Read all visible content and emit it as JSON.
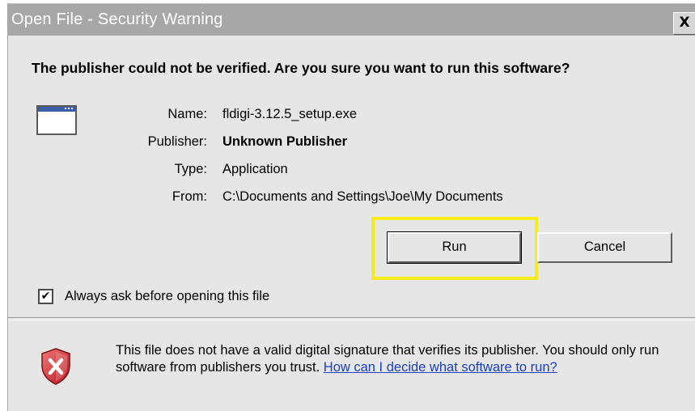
{
  "dialog": {
    "title": "Open File - Security Warning",
    "close_glyph": "X",
    "question": "The publisher could not be verified.  Are you sure you want to run this software?"
  },
  "file_info": {
    "icon": "application-window-icon",
    "name_label": "Name:",
    "name_value": "fldigi-3.12.5_setup.exe",
    "publisher_label": "Publisher:",
    "publisher_value": "Unknown Publisher",
    "type_label": "Type:",
    "type_value": "Application",
    "from_label": "From:",
    "from_value": "C:\\Documents and Settings\\Joe\\My Documents"
  },
  "buttons": {
    "run_label": "Run",
    "cancel_label": "Cancel",
    "highlight_color": "#f6ec1c"
  },
  "checkbox": {
    "checked": true,
    "mark": "✔",
    "label": "Always ask before opening this file"
  },
  "warning": {
    "icon": "security-shield-icon",
    "text": "This file does not have a valid digital signature that verifies its publisher. You should only run software from publishers you trust.",
    "link_text": "How can I decide what software to run?",
    "link_color": "#1a3fbf"
  }
}
